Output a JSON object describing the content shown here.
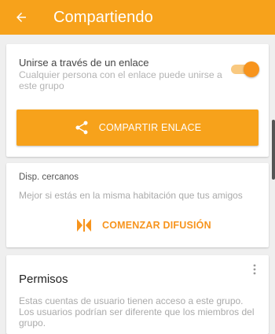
{
  "header": {
    "title": "Compartiendo",
    "back_icon": "arrow-left-icon"
  },
  "link_section": {
    "label": "Unirse a través de un enlace",
    "description": "Cualquier persona con el enlace puede unirse a este grupo",
    "toggle_on": true,
    "share_button_label": "COMPARTIR ENLACE",
    "share_icon": "share-icon"
  },
  "nearby_section": {
    "label": "Disp. cercanos",
    "description": "Mejor si estás en la misma habitación que tus amigos",
    "broadcast_button_label": "COMENZAR DIFUSIÓN",
    "broadcast_icon": "broadcast-icon"
  },
  "permissions_section": {
    "title": "Permisos",
    "description": "Estas cuentas de usuario tienen acceso a este grupo. Los usuarios podrían ser diferente que los miembros del grupo.",
    "menu_icon": "more-vert-icon"
  },
  "colors": {
    "accent": "#f7a21b",
    "toggle_thumb": "#f7941d",
    "toggle_track": "#f9c980",
    "background": "#efefef"
  }
}
